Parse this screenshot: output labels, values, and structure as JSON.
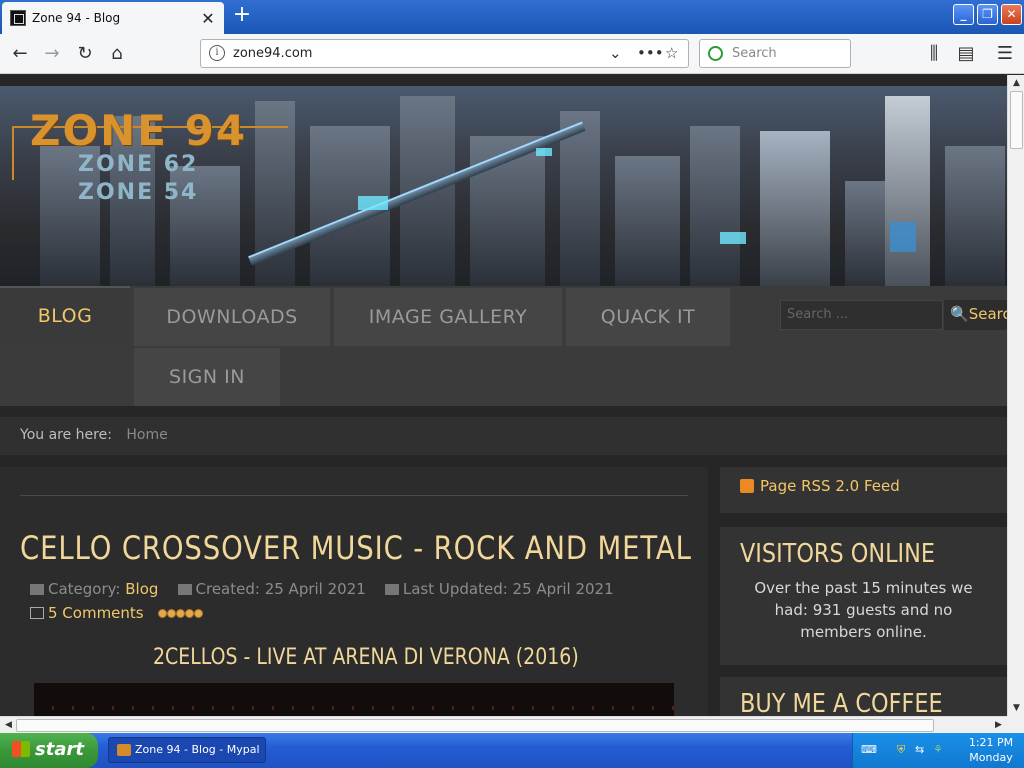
{
  "browser": {
    "tab_title": "Zone 94 - Blog",
    "new_tab": "+",
    "url": "zone94.com",
    "search_placeholder": "Search",
    "window_controls": {
      "minimize": "_",
      "restore": "❐",
      "close": "✕"
    }
  },
  "site": {
    "logo": {
      "main": "ZONE 94",
      "sub1": "ZONE 62",
      "sub2": "ZONE 54"
    },
    "menu": [
      {
        "label": "BLOG",
        "active": true
      },
      {
        "label": "DOWNLOADS",
        "active": false
      },
      {
        "label": "IMAGE GALLERY",
        "active": false
      },
      {
        "label": "QUACK IT",
        "active": false
      },
      {
        "label": "SIGN IN",
        "active": false
      }
    ],
    "search": {
      "placeholder": "Search ...",
      "button": "Search"
    },
    "breadcrumb": {
      "label": "You are here:",
      "home": "Home"
    },
    "article": {
      "title": "CELLO CROSSOVER MUSIC - ROCK AND METAL",
      "category_label": "Category:",
      "category": "Blog",
      "created": "Created: 25 April 2021",
      "updated": "Last Updated: 25 April 2021",
      "comments": "5 Comments",
      "rating_stars": 5,
      "subtitle": "2CELLOS - LIVE AT ARENA DI VERONA (2016)"
    },
    "sidebar": {
      "rss": "Page RSS 2.0 Feed",
      "visitors_title": "VISITORS ONLINE",
      "visitors_text": "Over the past 15 minutes we had: 931 guests and no members online.",
      "coffee_title": "BUY ME A COFFEE"
    }
  },
  "taskbar": {
    "start": "start",
    "task": "Zone 94 - Blog - Mypal",
    "time": "1:21 PM",
    "day": "Monday"
  },
  "colors": {
    "accent": "#f0c869",
    "title": "#f1d79a",
    "titlebar": "#2f6fd1"
  }
}
